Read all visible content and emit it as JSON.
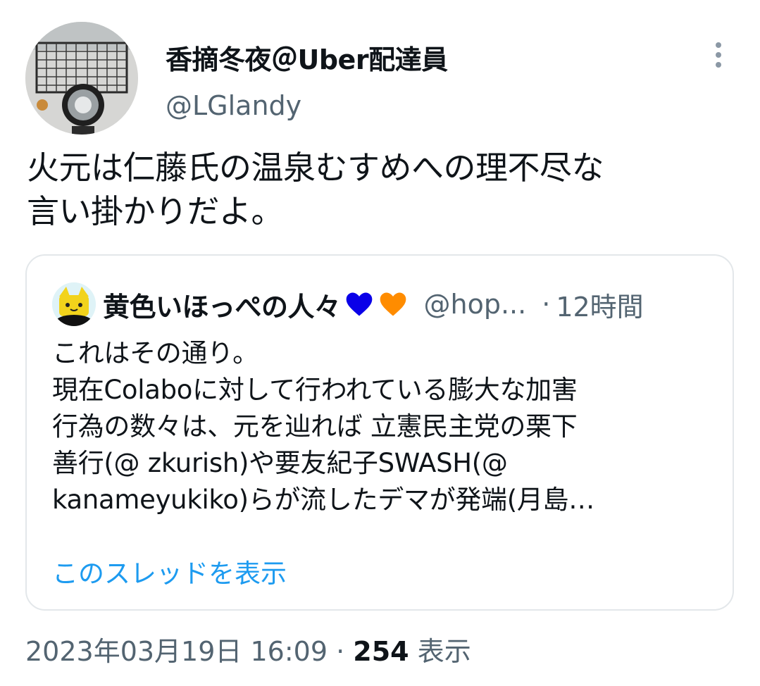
{
  "author": {
    "display_name": "香摘冬夜＠Uber配達員",
    "handle": "@LGlandy",
    "avatar_icon": "scooter-basket-headlight-photo"
  },
  "tweet": {
    "text_lines": [
      "火元は仁藤氏の温泉むすめへの理不尽な",
      "言い掛かりだよ。"
    ]
  },
  "more_icon": "more-vertical-icon",
  "quoted": {
    "display_name": "黄色いほっぺの人々",
    "heart_colors": [
      "#0a00e8",
      "#ff8c00"
    ],
    "handle": "@hop...",
    "separator": "·",
    "time": "12時間",
    "body_lines": [
      "これはその通り。",
      "現在Colaboに対して行われている膨大な加害",
      "行為の数々は、元を辿れば 立憲民主党の栗下",
      "善行(@ zkurish)や要友紀子SWASH(@",
      "kanameyukiko)らが流したデマが発端(月島…"
    ],
    "show_thread_label": "このスレッドを表示"
  },
  "meta": {
    "timestamp": "2023年03月19日 16:09",
    "separator": "·",
    "views_count": "254",
    "views_label": "表示"
  }
}
